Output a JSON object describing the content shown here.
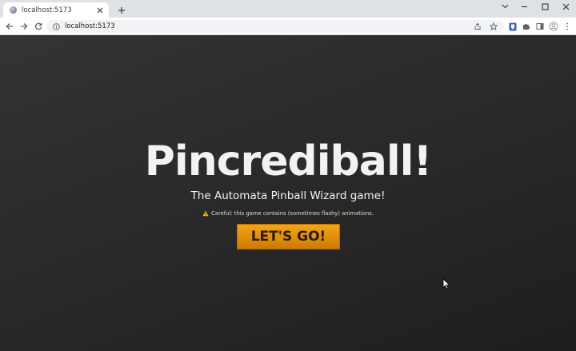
{
  "browser": {
    "tab": {
      "title": "localhost:5173"
    },
    "address_bar": {
      "url": "localhost:5173"
    }
  },
  "page": {
    "title": "Pincrediball!",
    "subtitle": "The Automata Pinball Wizard game!",
    "warning": "Careful: this game contains (sometimes flashy) animations.",
    "start_button_label": "LET'S GO!"
  },
  "colors": {
    "button_orange": "#e08c06",
    "page_background": "#2b2b2b",
    "warning_icon": "#f4b400"
  }
}
